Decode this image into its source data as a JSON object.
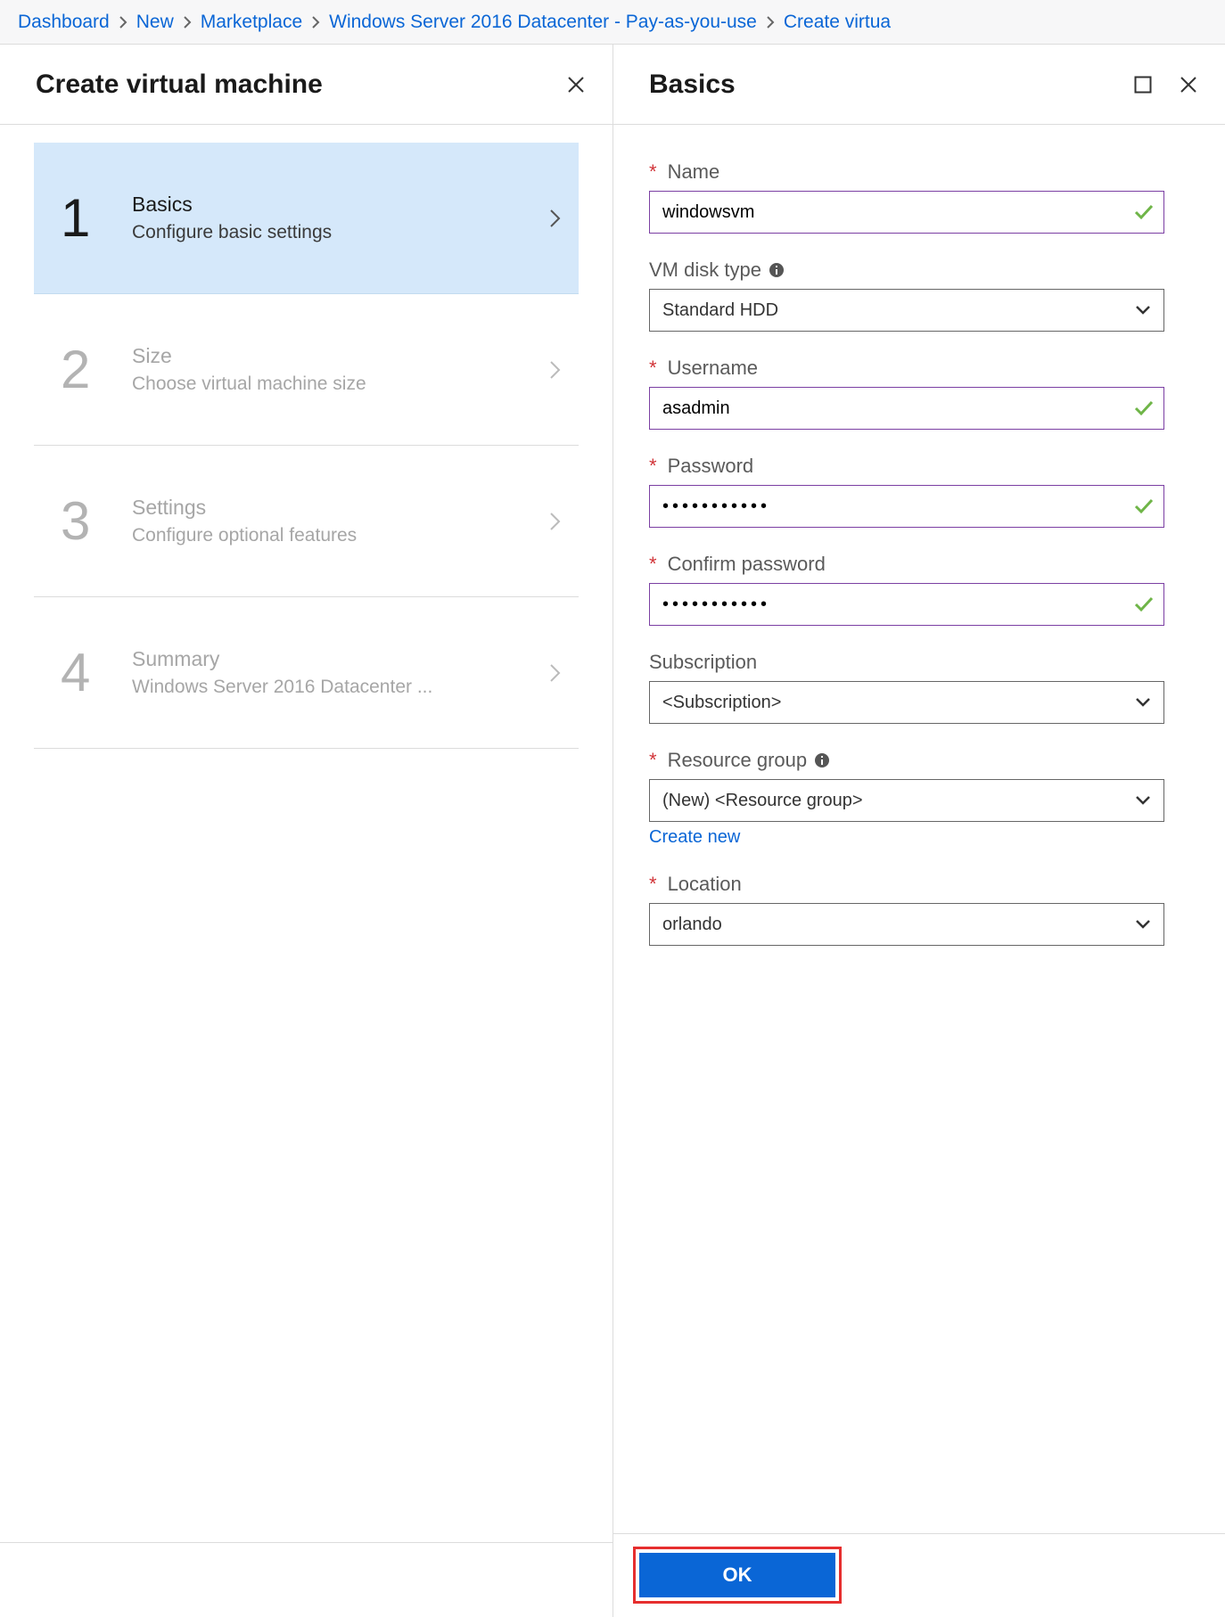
{
  "breadcrumb": [
    "Dashboard",
    "New",
    "Marketplace",
    "Windows Server 2016 Datacenter - Pay-as-you-use",
    "Create virtua"
  ],
  "left": {
    "title": "Create virtual machine",
    "steps": [
      {
        "num": "1",
        "title": "Basics",
        "sub": "Configure basic settings",
        "active": true
      },
      {
        "num": "2",
        "title": "Size",
        "sub": "Choose virtual machine size",
        "active": false
      },
      {
        "num": "3",
        "title": "Settings",
        "sub": "Configure optional features",
        "active": false
      },
      {
        "num": "4",
        "title": "Summary",
        "sub": "Windows Server 2016 Datacenter ...",
        "active": false
      }
    ]
  },
  "right": {
    "title": "Basics",
    "fields": {
      "name": {
        "label": "Name",
        "required": true,
        "value": "windowsvm",
        "valid": true
      },
      "disk": {
        "label": "VM disk type",
        "required": false,
        "value": "Standard HDD"
      },
      "username": {
        "label": "Username",
        "required": true,
        "value": "asadmin",
        "valid": true
      },
      "password": {
        "label": "Password",
        "required": true,
        "value": "•••••••••••",
        "valid": true
      },
      "confirm": {
        "label": "Confirm password",
        "required": true,
        "value": "•••••••••••",
        "valid": true
      },
      "subscription": {
        "label": "Subscription",
        "required": false,
        "value": "<Subscription>"
      },
      "resource_group": {
        "label": "Resource group",
        "required": true,
        "value": "(New)  <Resource group>",
        "link": "Create new"
      },
      "location": {
        "label": "Location",
        "required": true,
        "value": "orlando"
      }
    },
    "ok": "OK"
  }
}
